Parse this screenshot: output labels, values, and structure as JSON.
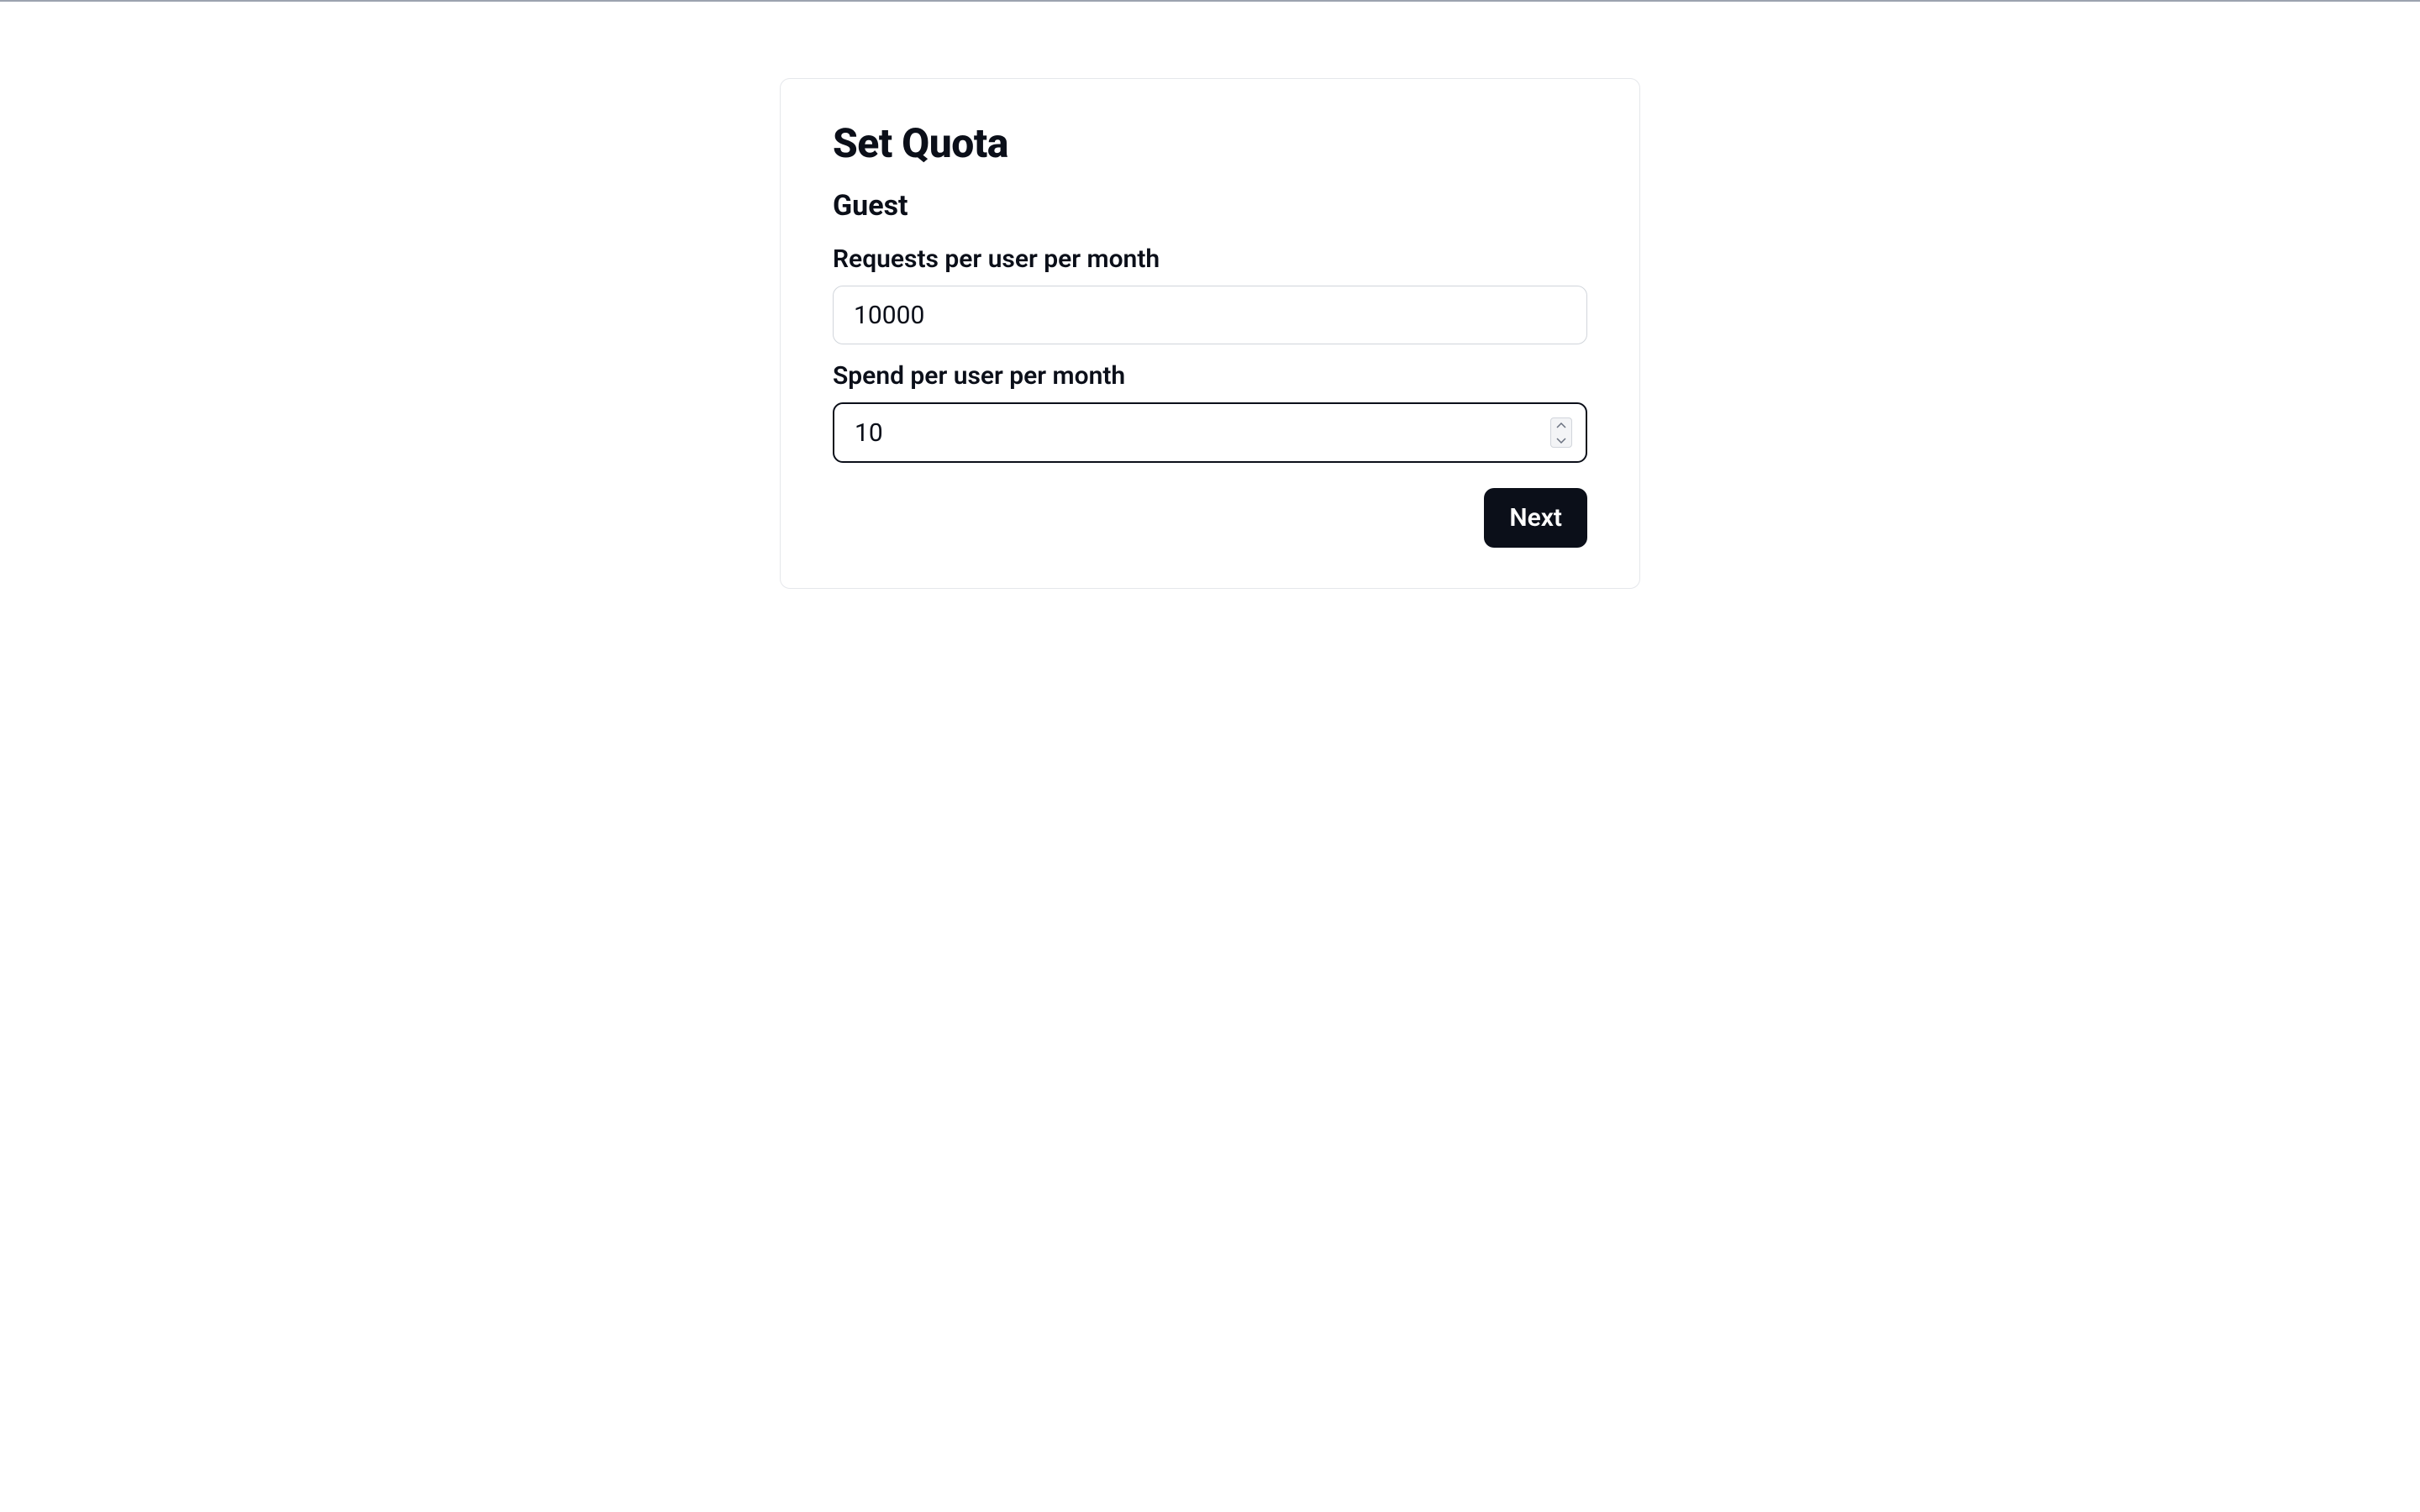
{
  "form": {
    "title": "Set Quota",
    "role": "Guest",
    "requests": {
      "label": "Requests per user per month",
      "value": "10000"
    },
    "spend": {
      "label": "Spend per user per month",
      "value": "10"
    },
    "next_label": "Next"
  }
}
